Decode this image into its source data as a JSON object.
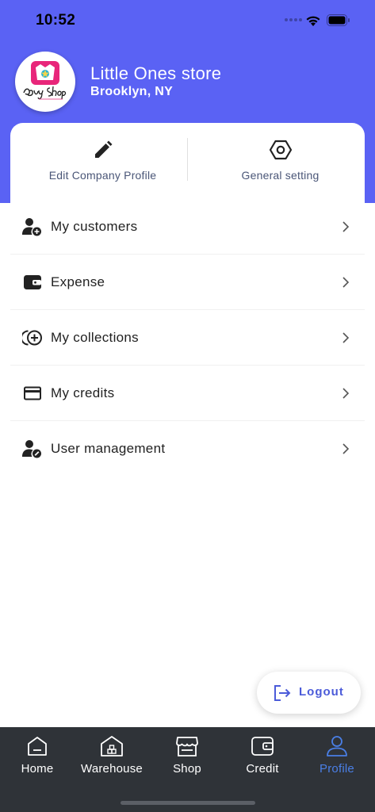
{
  "status_bar": {
    "time": "10:52"
  },
  "profile": {
    "logo_text": "Baby Shop",
    "store_name": "Little Ones store",
    "location": "Brooklyn, NY"
  },
  "quick_actions": {
    "edit_company_profile": "Edit Company Profile",
    "general_setting": "General setting"
  },
  "menu": {
    "items": [
      {
        "label": "My customers",
        "icon": "add-user-icon"
      },
      {
        "label": "Expense",
        "icon": "wallet-icon"
      },
      {
        "label": "My collections",
        "icon": "collections-icon"
      },
      {
        "label": "My credits",
        "icon": "credit-card-icon"
      },
      {
        "label": "User management",
        "icon": "user-gear-icon"
      }
    ]
  },
  "logout": {
    "label": "Logout"
  },
  "tabbar": {
    "tabs": [
      {
        "label": "Home",
        "icon": "home-icon"
      },
      {
        "label": "Warehouse",
        "icon": "warehouse-icon"
      },
      {
        "label": "Shop",
        "icon": "shop-icon"
      },
      {
        "label": "Credit",
        "icon": "wallet-icon"
      },
      {
        "label": "Profile",
        "icon": "profile-icon"
      }
    ],
    "active": "Profile"
  },
  "colors": {
    "header": "#5a62f4",
    "accent": "#4a7fe6",
    "logout_text": "#4b5bd9",
    "tabbar": "#2f3338"
  }
}
